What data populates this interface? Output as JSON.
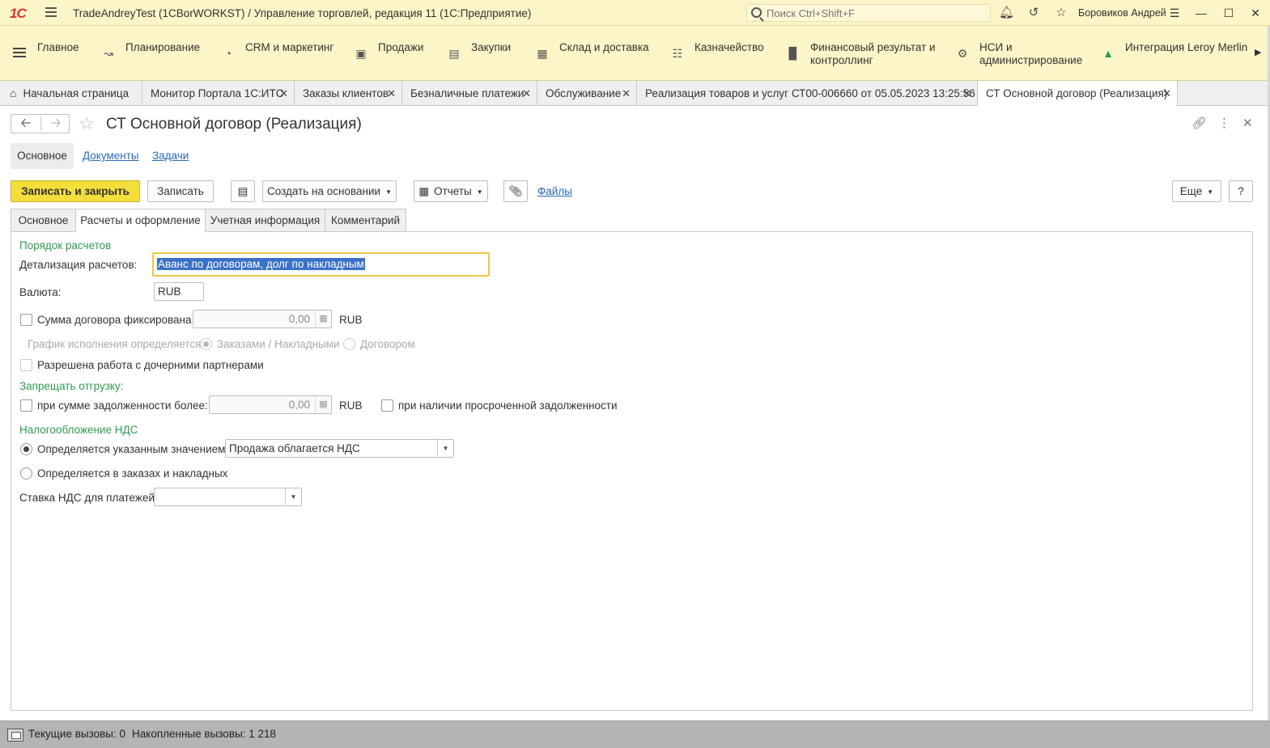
{
  "titlebar": {
    "logo": "1С",
    "title": "TradeAndreyTest (1CBorWORKST) / Управление торговлей, редакция 11  (1С:Предприятие)",
    "search_placeholder": "Поиск Ctrl+Shift+F",
    "user": "Боровиков Андрей"
  },
  "sections": [
    {
      "label": "Главное",
      "icon": "menu-icon"
    },
    {
      "label": "Планирование",
      "icon": "planning-icon"
    },
    {
      "label": "CRM и маркетинг",
      "icon": "crm-icon"
    },
    {
      "label": "Продажи",
      "icon": "bag-icon"
    },
    {
      "label": "Закупки",
      "icon": "cart-icon"
    },
    {
      "label": "Склад и доставка",
      "icon": "warehouse-icon"
    },
    {
      "label": "Казначейство",
      "icon": "coins-icon"
    },
    {
      "label": "Финансовый результат и",
      "label2": "контроллинг",
      "icon": "chart-icon"
    },
    {
      "label": "НСИ и",
      "label2": "администрирование",
      "icon": "gear-icon"
    },
    {
      "label": "Интеграция Leroy Merlin",
      "icon": "house-icon"
    }
  ],
  "open_tabs": [
    {
      "label": "Начальная страница"
    },
    {
      "label": "Монитор Портала 1С:ИТС"
    },
    {
      "label": "Заказы клиентов"
    },
    {
      "label": "Безналичные платежи"
    },
    {
      "label": "Обслуживание"
    },
    {
      "label": "Реализация товаров и услуг СТ00-006660 от 05.05.2023 13:25:56"
    },
    {
      "label": "СТ Основной договор (Реализация)"
    }
  ],
  "form": {
    "title": "СТ Основной договор (Реализация)",
    "nav": [
      "Основное",
      "Документы",
      "Задачи"
    ],
    "commands": {
      "save_close": "Записать и закрыть",
      "save": "Записать",
      "create_based": "Создать на основании",
      "reports": "Отчеты",
      "files": "Файлы",
      "more": "Еще",
      "help": "?"
    },
    "tabs": [
      "Основное",
      "Расчеты и оформление",
      "Учетная информация",
      "Комментарий"
    ],
    "fields": {
      "group_payment": "Порядок расчетов",
      "detail_label": "Детализация расчетов:",
      "detail_value": "Аванс по договорам, долг по накладным",
      "currency_label": "Валюта:",
      "currency_value": "RUB",
      "fixed_sum_label": "Сумма договора фиксирована",
      "fixed_sum_value": "0,00",
      "fixed_sum_currency": "RUB",
      "schedule_label": "График исполнения определяется:",
      "schedule_opt1": "Заказами / Накладными",
      "schedule_opt2": "Договором",
      "child_partners_label": "Разрешена работа с дочерними партнерами",
      "group_forbid": "Запрещать отгрузку:",
      "debt_label": "при сумме задолженности более:",
      "debt_value": "0,00",
      "debt_currency": "RUB",
      "overdue_label": "при наличии просроченной задолженности",
      "group_vat": "Налогообложение НДС",
      "vat_opt1": "Определяется указанным значением",
      "vat_value": "Продажа облагается НДС",
      "vat_opt2": "Определяется в заказах и накладных",
      "vat_rate_label": "Ставка НДС для платежей:",
      "vat_rate_value": ""
    }
  },
  "statusbar": {
    "current_calls": "Текущие вызовы: 0",
    "accumulated_calls": "Накопленные вызовы: 1 218"
  },
  "colors": {
    "header_bg": "#fbf5c7",
    "primary_button": "#f3de3c",
    "group_title": "#2e9a52",
    "link": "#2a6ab0",
    "selection": "#3a71c8"
  }
}
